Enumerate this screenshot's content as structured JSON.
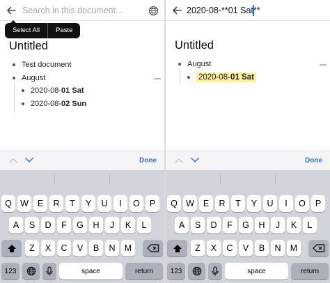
{
  "left": {
    "search": {
      "placeholder": "Search in this document..."
    },
    "context_menu": {
      "select_all": "Select All",
      "paste": "Paste"
    },
    "doc": {
      "title": "Untitled",
      "items": [
        {
          "label": "Test document"
        },
        {
          "label": "August"
        }
      ],
      "children": [
        {
          "prefix": "2020-08-",
          "bold_day": "01",
          "bold_weekday": "Sat"
        },
        {
          "prefix": "2020-08-",
          "bold_day": "02",
          "bold_weekday": "Sun"
        }
      ]
    },
    "toolbar": {
      "done": "Done"
    }
  },
  "right": {
    "search": {
      "query": "2020-08-**01 Sat**"
    },
    "doc": {
      "title": "Untitled",
      "items": [
        {
          "label": "August"
        }
      ],
      "match": {
        "prefix": "2020-08-",
        "bold_day": "01",
        "bold_weekday": "Sat"
      }
    },
    "toolbar": {
      "done": "Done"
    }
  },
  "keyboard": {
    "row1": [
      "Q",
      "W",
      "E",
      "R",
      "T",
      "Y",
      "U",
      "I",
      "O",
      "P"
    ],
    "row2": [
      "A",
      "S",
      "D",
      "F",
      "G",
      "H",
      "J",
      "K",
      "L"
    ],
    "row3": [
      "Z",
      "X",
      "C",
      "V",
      "B",
      "N",
      "M"
    ],
    "numbers_key": "123",
    "space_key": "space",
    "return_key": "return"
  },
  "colors": {
    "accent": "#2e6ff0",
    "caret": "#1a73e8",
    "highlight": "#fff09a",
    "keyboard_bg": "#d1d4db"
  }
}
